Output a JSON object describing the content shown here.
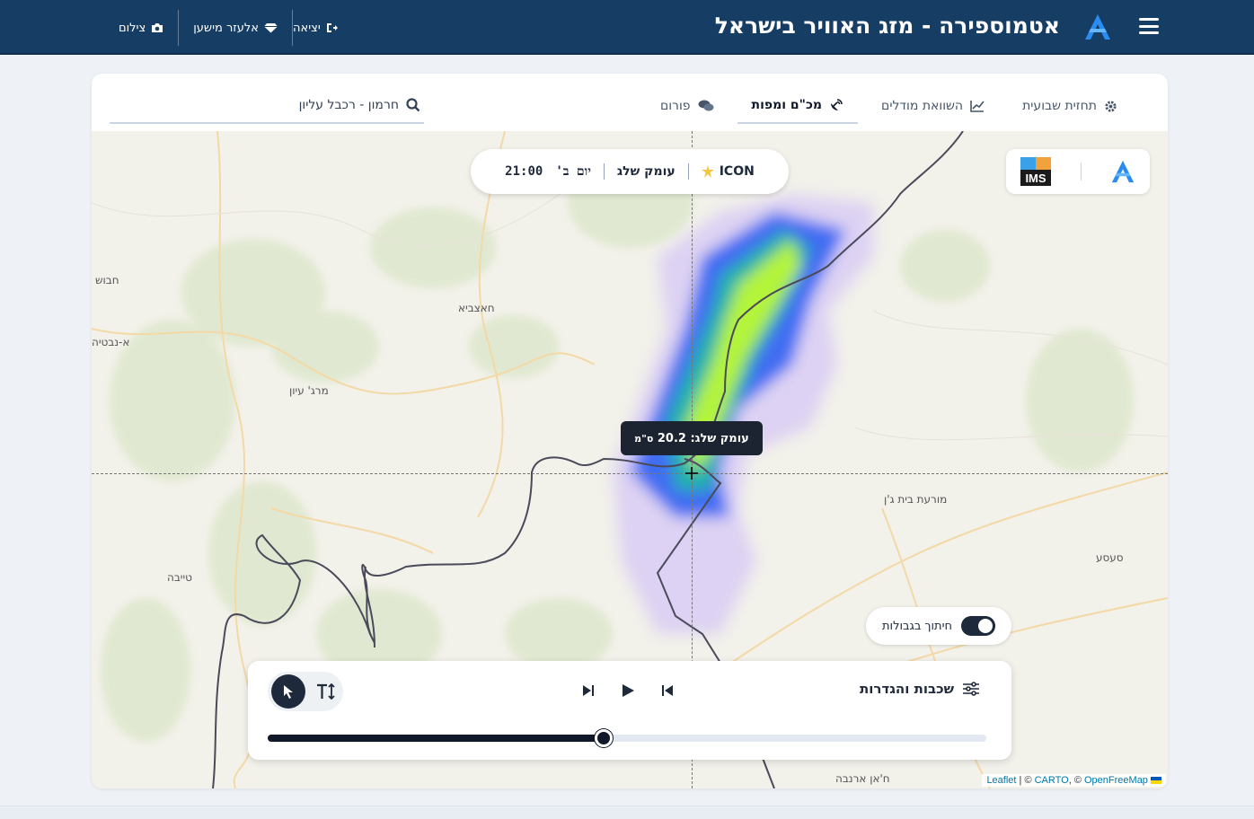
{
  "header": {
    "title": "אטמוספירה - מזג האוויר בישראל",
    "actions": [
      {
        "label": "צילום",
        "icon": "camera-icon"
      },
      {
        "label": "אלעזר מישען",
        "icon": "diamond-icon"
      },
      {
        "label": "יציאה",
        "icon": "logout-icon"
      }
    ]
  },
  "tabs": [
    {
      "label": "תחזית שבועית",
      "icon": "gear-icon",
      "active": false
    },
    {
      "label": "השוואת מודלים",
      "icon": "chart-line-icon",
      "active": false
    },
    {
      "label": "מכ\"ם ומפות",
      "icon": "satellite-dish-icon",
      "active": true
    },
    {
      "label": "פורום",
      "icon": "comments-icon",
      "active": false
    }
  ],
  "search": {
    "value": "חרמון - רכבל עליון"
  },
  "map_info": {
    "model": "ICON",
    "layer": "עומק שלג",
    "day": "יום ב'",
    "time": "21:00"
  },
  "tooltip": {
    "label": "עומק שלג:",
    "value": "20.2",
    "unit": "ס\"מ"
  },
  "places": [
    "חבוש",
    "א-נבטיה",
    "חאצביא",
    "מרג' עיון",
    "טייבה",
    "מורעת בית ג'ן",
    "סעסע",
    "ח'אן ארנבה"
  ],
  "toggle": {
    "label": "חיתוך בגבולות",
    "on": true
  },
  "controls": {
    "layers_label": "שכבות והגדרות",
    "timeline_progress": 0.468
  },
  "attribution": {
    "leaflet": "Leaflet",
    "sep1": " | © ",
    "carto": "CARTO",
    "sep2": ", © ",
    "ofm": "OpenFreeMap"
  },
  "colors": {
    "header_bg": "#163d63",
    "accent": "#1e293b",
    "snow_low": "#c9b8f0",
    "snow_mid": "#3b6cf0",
    "snow_high": "#b6f53a"
  }
}
